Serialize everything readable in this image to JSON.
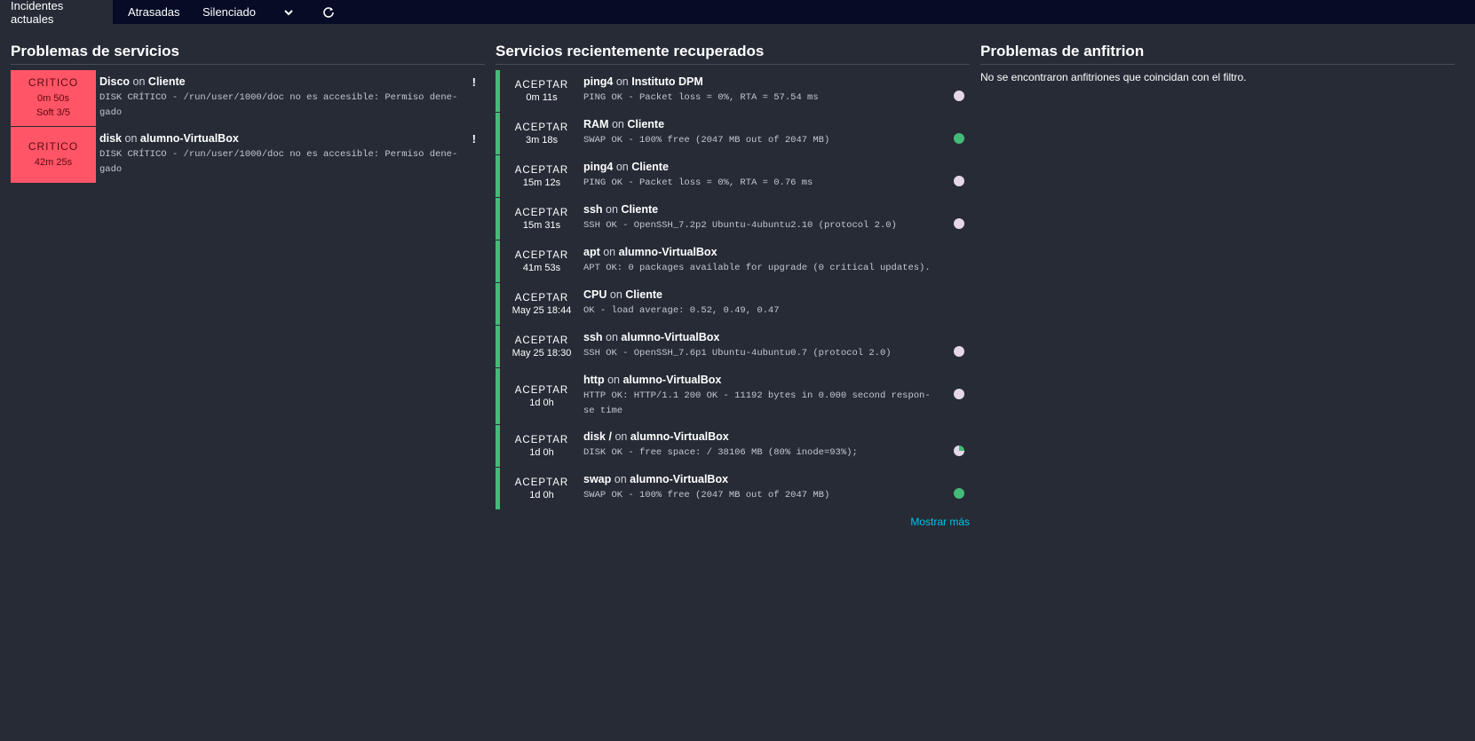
{
  "tabs": [
    {
      "label": "Incidentes actuales"
    },
    {
      "label": "Atrasadas"
    },
    {
      "label": "Silenciado"
    }
  ],
  "service_problems": {
    "title": "Problemas de servicios",
    "items": [
      {
        "state": "CRITICO",
        "time": "0m 50s",
        "soft": "Soft 3/5",
        "service": "Disco",
        "on": "on",
        "host": "Cliente",
        "output": "DISK CRÍTICO - /run/user/1000/doc no es accesible: Permiso dene-\ngado",
        "flag": "!"
      },
      {
        "state": "CRITICO",
        "time": "42m 25s",
        "soft": "",
        "service": "disk",
        "on": "on",
        "host": "alumno-VirtualBox",
        "output": "DISK CRÍTICO - /run/user/1000/doc no es accesible: Permiso dene-\ngado",
        "flag": "!"
      }
    ]
  },
  "recovered": {
    "title": "Servicios recientemente recuperados",
    "items": [
      {
        "state": "ACEPTAR",
        "time": "0m 11s",
        "service": "ping4",
        "on": "on",
        "host": "Instituto DPM",
        "output": "PING OK - Packet loss = 0%, RTA = 57.54 ms",
        "dot": "pending"
      },
      {
        "state": "ACEPTAR",
        "time": "3m 18s",
        "service": "RAM",
        "on": "on",
        "host": "Cliente",
        "output": "SWAP OK - 100% free (2047 MB out of 2047 MB)",
        "dot": "ok"
      },
      {
        "state": "ACEPTAR",
        "time": "15m 12s",
        "service": "ping4",
        "on": "on",
        "host": "Cliente",
        "output": "PING OK - Packet loss = 0%, RTA = 0.76 ms",
        "dot": "pending"
      },
      {
        "state": "ACEPTAR",
        "time": "15m 31s",
        "service": "ssh",
        "on": "on",
        "host": "Cliente",
        "output": "SSH OK - OpenSSH_7.2p2 Ubuntu-4ubuntu2.10 (protocol 2.0)",
        "dot": "pending"
      },
      {
        "state": "ACEPTAR",
        "time": "41m 53s",
        "service": "apt",
        "on": "on",
        "host": "alumno-VirtualBox",
        "output": "APT OK: 0 packages available for upgrade (0 critical updates).",
        "dot": ""
      },
      {
        "state": "ACEPTAR",
        "time": "May 25 18:44",
        "service": "CPU",
        "on": "on",
        "host": "Cliente",
        "output": "OK - load average: 0.52, 0.49, 0.47",
        "dot": ""
      },
      {
        "state": "ACEPTAR",
        "time": "May 25 18:30",
        "service": "ssh",
        "on": "on",
        "host": "alumno-VirtualBox",
        "output": "SSH OK - OpenSSH_7.6p1 Ubuntu-4ubuntu0.7 (protocol 2.0)",
        "dot": "pending"
      },
      {
        "state": "ACEPTAR",
        "time": "1d 0h",
        "service": "http",
        "on": "on",
        "host": "alumno-VirtualBox",
        "output": "HTTP OK: HTTP/1.1 200 OK - 11192 bytes in 0.000 second respon-\nse time",
        "dot": "pending"
      },
      {
        "state": "ACEPTAR",
        "time": "1d 0h",
        "service": "disk /",
        "on": "on",
        "host": "alumno-VirtualBox",
        "output": "DISK OK - free space: / 38106 MB (80% inode=93%);",
        "dot": "pie"
      },
      {
        "state": "ACEPTAR",
        "time": "1d 0h",
        "service": "swap",
        "on": "on",
        "host": "alumno-VirtualBox",
        "output": "SWAP OK - 100% free (2047 MB out of 2047 MB)",
        "dot": "ok"
      }
    ],
    "show_more": "Mostrar más"
  },
  "host_problems": {
    "title": "Problemas de anfitrion",
    "empty": "No se encontraron anfitriones que coincidan con el filtro."
  },
  "colors": {
    "background": "#262b36",
    "topbar": "#060b26",
    "critical": "#ff5566",
    "ok": "#44bb77",
    "pending": "#e5d6ea",
    "link": "#00c3ed"
  },
  "icons": {
    "dropdown": "chevron-down-icon",
    "refresh": "refresh-icon"
  }
}
